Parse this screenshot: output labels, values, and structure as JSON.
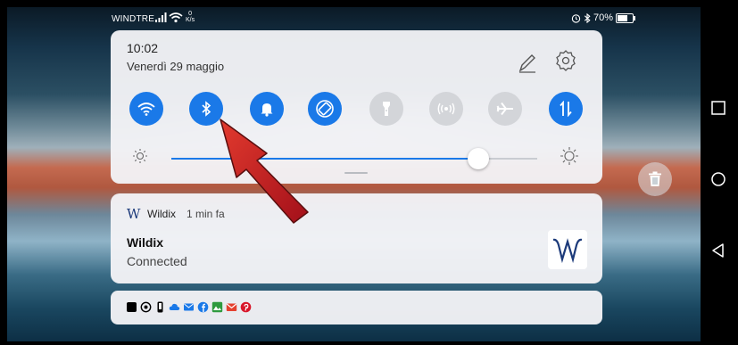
{
  "status_bar": {
    "carrier": "WINDTRE",
    "speed_value": "0",
    "speed_unit": "K/s",
    "battery": "70%"
  },
  "quick_settings": {
    "time": "10:02",
    "date": "Venerdì 29 maggio",
    "brightness_level": 0.84,
    "tiles": [
      {
        "name": "wifi",
        "icon": "wifi-icon",
        "state": "on"
      },
      {
        "name": "bluetooth",
        "icon": "bluetooth-icon",
        "state": "on"
      },
      {
        "name": "sound",
        "icon": "bell-icon",
        "state": "on"
      },
      {
        "name": "auto-rotate",
        "icon": "rotate-icon",
        "state": "on"
      },
      {
        "name": "flashlight",
        "icon": "flashlight-icon",
        "state": "off"
      },
      {
        "name": "hotspot",
        "icon": "hotspot-icon",
        "state": "off"
      },
      {
        "name": "airplane-mode",
        "icon": "airplane-icon",
        "state": "off"
      },
      {
        "name": "mobile-data",
        "icon": "mobile-data-icon",
        "state": "on"
      }
    ]
  },
  "notification": {
    "app_name": "Wildix",
    "time": "1 min fa",
    "title": "Wildix",
    "text": "Connected",
    "logo_letter": "W"
  },
  "tray_icons": [
    "black-square-icon",
    "whatsapp-icon",
    "phone-icon",
    "cloud-icon",
    "outlook-icon",
    "facebook-icon",
    "gallery-icon",
    "gmail-icon",
    "pinterest-icon"
  ],
  "colors": {
    "accent": "#1a79e8",
    "tile_off": "#d3d5d9",
    "arrow": "#c81e1e"
  }
}
